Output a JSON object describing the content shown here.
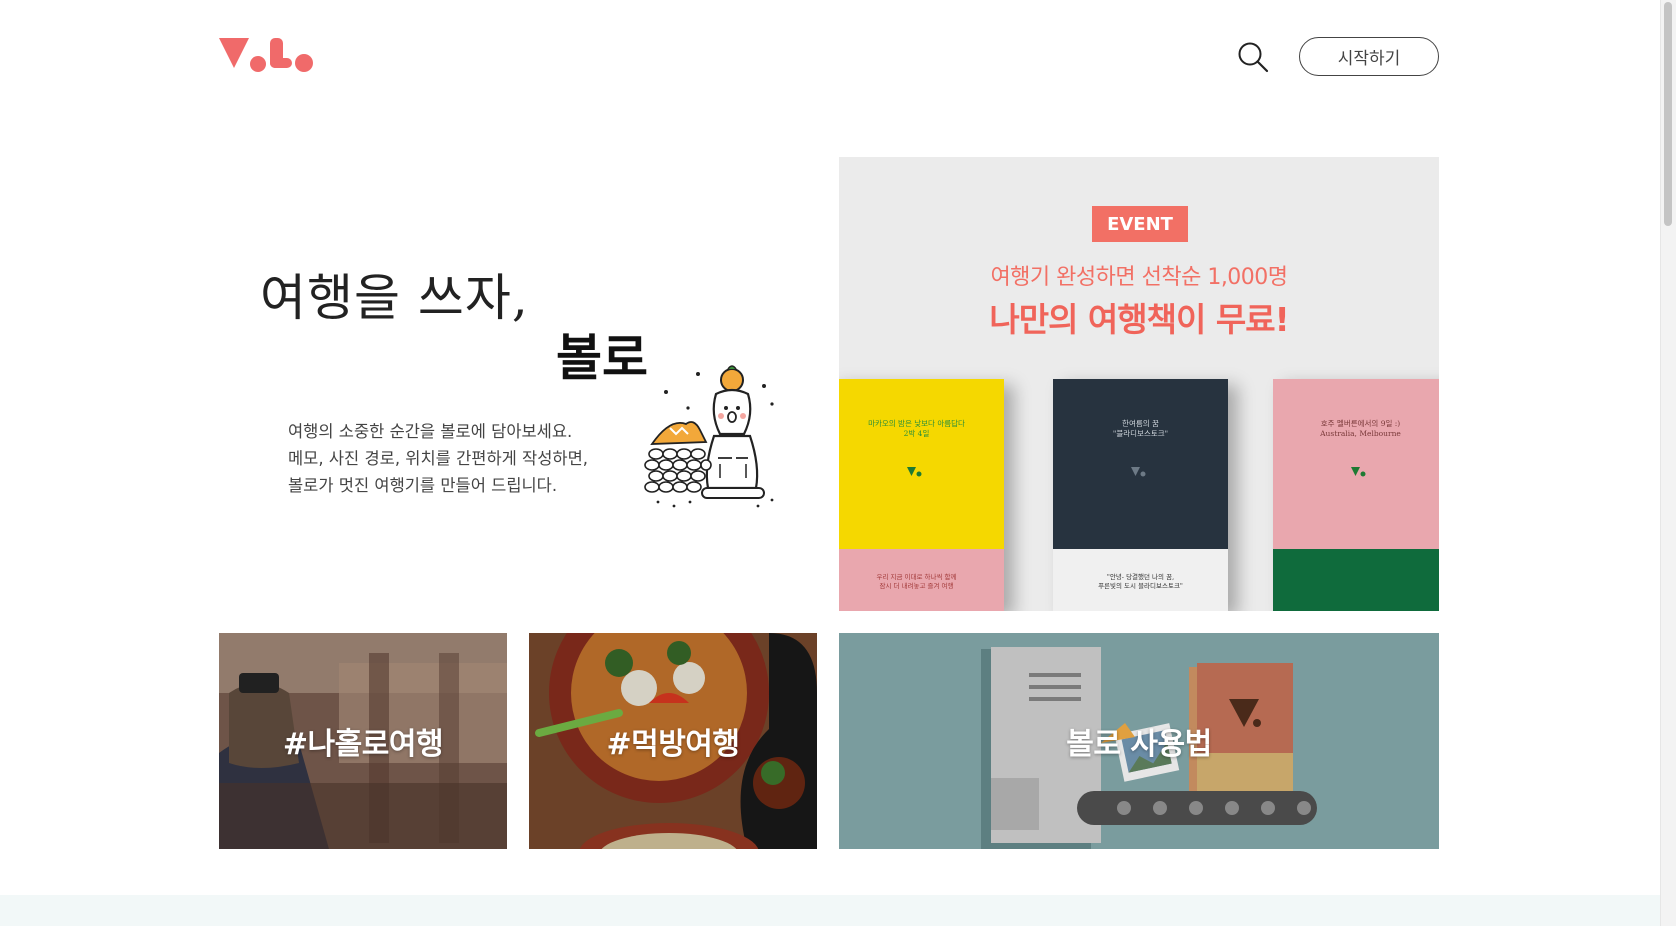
{
  "header": {
    "logo_alt": "Volo",
    "search_icon": "search-icon",
    "start_button_label": "시작하기"
  },
  "hero": {
    "headline_line1": "여행을 쓰자,",
    "headline_line2": "볼로",
    "description": [
      "여행의 소중한 순간을 볼로에 담아보세요.",
      "메모, 사진 경로, 위치를 간편하게 작성하면,",
      "볼로가 멋진 여행기를 만들어 드립니다."
    ]
  },
  "event": {
    "badge": "EVENT",
    "subtitle": "여행기 완성하면 선착순 1,000명",
    "title": "나만의 여행책이 무료!",
    "books": [
      {
        "title_lines": [
          "마카오의 밤은 낮보다 아름답다",
          "2박 4일"
        ],
        "footer_lines": [
          "우리 지금 이대로 하나씩 함께",
          "잠시 더 내려놓고 즐겨 여행"
        ],
        "top_color": "#f5d800",
        "bottom_color": "#e9a7ae",
        "text_color": "#2a8f3a"
      },
      {
        "title_lines": [
          "한여름의 꿈",
          "\"블라디보스토크\""
        ],
        "footer_lines": [
          "\"안녕- 당결했던 나의 꿈,",
          "푸른빛의 도시 블라디보스토크\""
        ],
        "top_color": "#27333f",
        "bottom_color": "#f0f0f0",
        "text_color": "#cfd6dc"
      },
      {
        "title_lines": [
          "호주 멜버른에서의 9일 :)",
          "Australia, Melbourne"
        ],
        "footer_lines": [
          "",
          ""
        ],
        "top_color": "#e9a7ae",
        "bottom_color": "#0f6b3c",
        "text_color": "#7a3a3a"
      }
    ]
  },
  "tiles": [
    {
      "label": "#나홀로여행"
    },
    {
      "label": "#먹방여행"
    },
    {
      "label": "볼로 사용법"
    }
  ],
  "colors": {
    "accent": "#f27065",
    "tile_guide_bg": "#7a9c9e"
  }
}
